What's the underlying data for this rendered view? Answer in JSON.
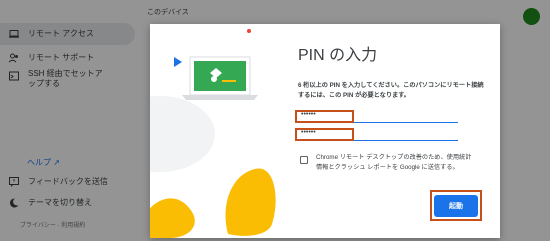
{
  "header": {
    "title": "このデバイス"
  },
  "sidebar": {
    "items": [
      {
        "label": "リモート アクセス",
        "icon": "laptop-icon",
        "active": true
      },
      {
        "label": "リモート サポート",
        "icon": "people-icon",
        "active": false
      },
      {
        "label": "SSH 経由でセットアップする",
        "icon": "terminal-icon",
        "active": false
      }
    ],
    "help_label": "ヘルプ",
    "feedback_label": "フィードバックを送信",
    "theme_label": "テーマを切り替え",
    "footer_links": "プライバシー · 利用規約"
  },
  "dialog": {
    "title": "PIN の入力",
    "description": "6 桁以上の PIN を入力してください。このパソコンにリモート接続するには、この PIN が必要となります。",
    "pin_value": "••••••",
    "pin_confirm_value": "••••••",
    "checkbox_label": "Chrome リモート デスクトップの改善のため、使用統計情報とクラッシュ レポートを Google に送信する。",
    "checkbox_checked": false,
    "start_button": "起動"
  },
  "colors": {
    "accent": "#1a73e8",
    "highlight": "#c5501c",
    "illustration_yellow": "#fbbc04",
    "illustration_green": "#34a853"
  }
}
